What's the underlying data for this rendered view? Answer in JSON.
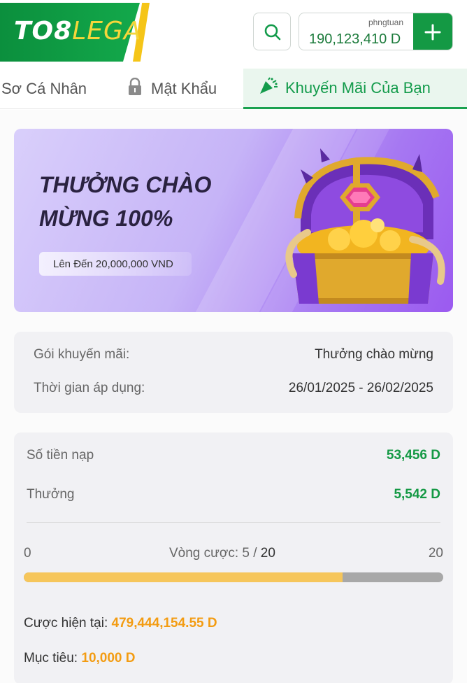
{
  "header": {
    "logo_main": "TO8",
    "logo_accent": "LEGA",
    "username": "phngtuan",
    "balance": "190,123,410 D"
  },
  "tabs": [
    {
      "label": "Sơ Cá Nhân",
      "icon": "profile-icon",
      "active": false
    },
    {
      "label": "Mật Khẩu",
      "icon": "lock-icon",
      "active": false
    },
    {
      "label": "Khuyến Mãi Của Bạn",
      "icon": "confetti-icon",
      "active": true
    }
  ],
  "banner": {
    "title": "THƯỞNG CHÀO\nMỪNG 100%",
    "pill": "Lên Đến 20,000,000 VND",
    "image": "treasure-chest"
  },
  "info": {
    "package_label": "Gói khuyến mãi:",
    "package_value": "Thưởng chào mừng",
    "period_label": "Thời gian áp dụng:",
    "period_value": "26/01/2025 - 26/02/2025"
  },
  "stats": {
    "deposit_label": "Số tiền nạp",
    "deposit_value": "53,456 D",
    "bonus_label": "Thưởng",
    "bonus_value": "5,542 D",
    "progress_min": "0",
    "progress_label": "Vòng cược: 5 / ",
    "progress_target": "20",
    "progress_max": "20",
    "progress_fraction": 0.76,
    "current_bet_label": "Cược hiện tại: ",
    "current_bet_value": "479,444,154.55 D",
    "target_label": "Mục tiêu: ",
    "target_value": "10,000 D"
  },
  "colors": {
    "brand_green": "#149944",
    "accent_yellow": "#f5c518",
    "orange": "#f39c12",
    "progress_fill": "#f6c65b"
  }
}
